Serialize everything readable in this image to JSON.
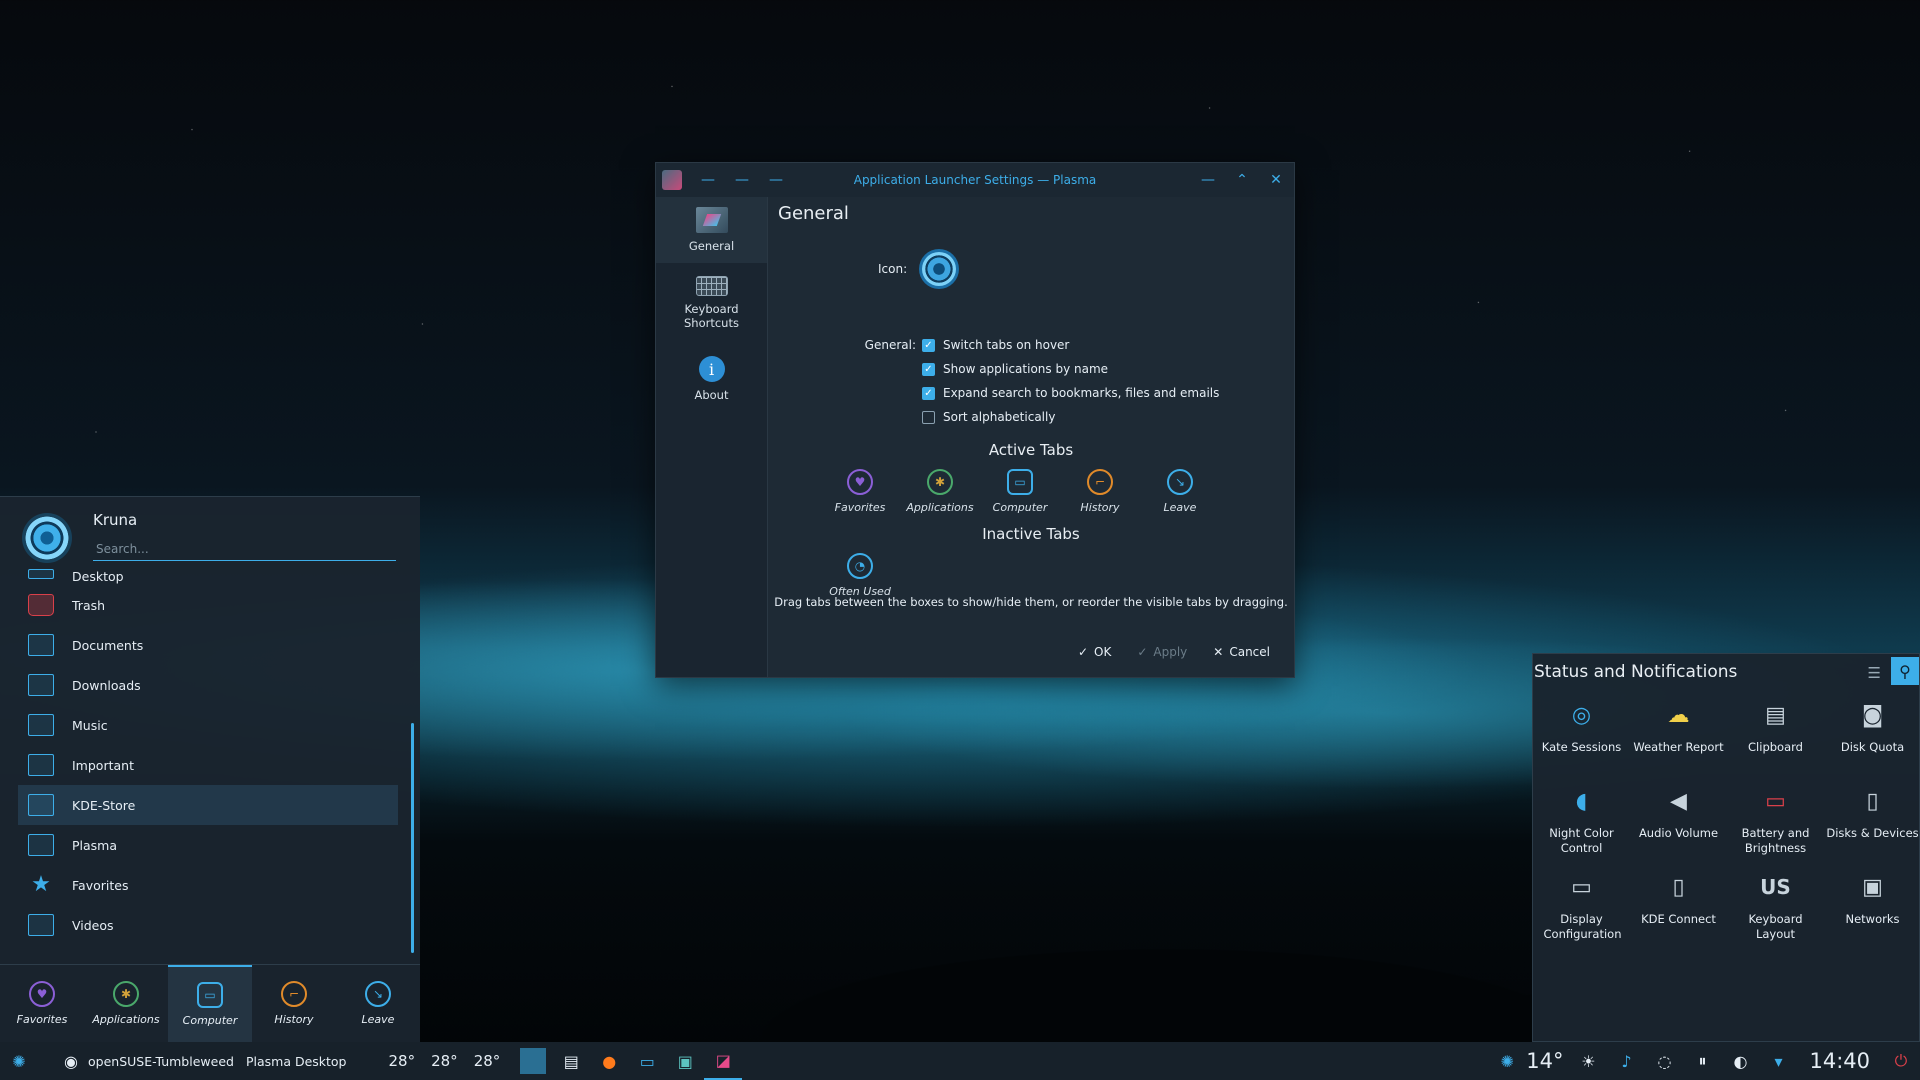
{
  "dialog": {
    "title": "Application Launcher Settings — Plasma",
    "sidebar": [
      {
        "label": "General"
      },
      {
        "label": "Keyboard Shortcuts"
      },
      {
        "label": "About"
      }
    ],
    "heading": "General",
    "icon_label": "Icon:",
    "general_label": "General:",
    "options": [
      {
        "label": "Switch tabs on hover",
        "checked": true
      },
      {
        "label": "Show applications by name",
        "checked": true
      },
      {
        "label": "Expand search to bookmarks, files and emails",
        "checked": true
      },
      {
        "label": "Sort alphabetically",
        "checked": false
      }
    ],
    "active_tabs_title": "Active Tabs",
    "active_tabs": [
      "Favorites",
      "Applications",
      "Computer",
      "History",
      "Leave"
    ],
    "inactive_tabs_title": "Inactive Tabs",
    "inactive_tabs": [
      "Often Used"
    ],
    "hint": "Drag tabs between the boxes to show/hide them, or reorder the visible tabs by dragging.",
    "buttons": {
      "ok": "OK",
      "apply": "Apply",
      "cancel": "Cancel"
    }
  },
  "launcher": {
    "user": "Kruna",
    "search_placeholder": "Search...",
    "items": [
      "Desktop",
      "Trash",
      "Documents",
      "Downloads",
      "Music",
      "Important",
      "KDE-Store",
      "Plasma",
      "Favorites",
      "Videos"
    ],
    "highlighted": "KDE-Store",
    "tabs": [
      "Favorites",
      "Applications",
      "Computer",
      "History",
      "Leave"
    ],
    "active_tab": "Computer"
  },
  "status_notifications": {
    "title": "Status and Notifications",
    "items": [
      {
        "label": "Kate Sessions",
        "icon": "kate-icon"
      },
      {
        "label": "Weather Report",
        "icon": "weather-icon"
      },
      {
        "label": "Clipboard",
        "icon": "clipboard-icon"
      },
      {
        "label": "Disk Quota",
        "icon": "disk-quota-icon"
      },
      {
        "label": "Night Color Control",
        "icon": "night-color-icon"
      },
      {
        "label": "Audio Volume",
        "icon": "speaker-icon"
      },
      {
        "label": "Battery and Brightness",
        "icon": "battery-icon"
      },
      {
        "label": "Disks & Devices",
        "icon": "usb-drive-icon"
      },
      {
        "label": "Display Configuration",
        "icon": "monitor-icon"
      },
      {
        "label": "KDE Connect",
        "icon": "phone-icon"
      },
      {
        "label": "Keyboard Layout",
        "icon": "keyboard-layout-icon",
        "glyph": "US"
      },
      {
        "label": "Networks",
        "icon": "network-icon"
      }
    ]
  },
  "taskbar": {
    "distro": "openSUSE-Tumbleweed",
    "desktop": "Plasma Desktop",
    "temps": [
      "28°",
      "28°",
      "28°"
    ],
    "weather_temp": "14°",
    "clock": "14:40"
  },
  "colors": {
    "accent": "#3daee9",
    "panel": "#1a242e",
    "danger": "#d9404a"
  }
}
